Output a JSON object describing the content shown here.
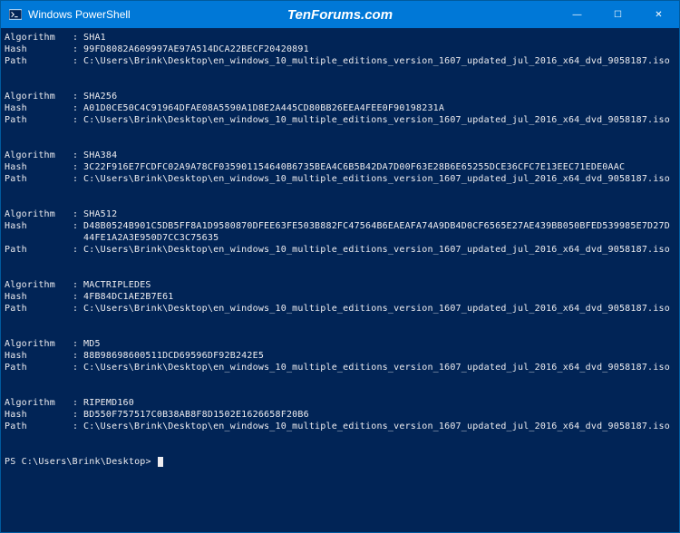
{
  "titlebar": {
    "icon_name": "powershell-icon",
    "title": "Windows PowerShell",
    "watermark": "TenForums.com",
    "min_glyph": "—",
    "max_glyph": "☐",
    "close_glyph": "✕"
  },
  "labels": {
    "algorithm": "Algorithm",
    "hash": "Hash",
    "path": "Path"
  },
  "path": "C:\\Users\\Brink\\Desktop\\en_windows_10_multiple_editions_version_1607_updated_jul_2016_x64_dvd_9058187.iso",
  "results": [
    {
      "algorithm": "SHA1",
      "hash": "99FD8082A609997AE97A514DCA22BECF20420891"
    },
    {
      "algorithm": "SHA256",
      "hash": "A01D0CE50C4C91964DFAE08A5590A1D8E2A445CD80BB26EEA4FEE0F90198231A"
    },
    {
      "algorithm": "SHA384",
      "hash": "3C22F916E7FCDFC02A9A78CF035901154640B6735BEA4C6B5B42DA7D00F63E28B6E65255DCE36CFC7E13EEC71EDE0AAC"
    },
    {
      "algorithm": "SHA512",
      "hash": "D48B0524B901C5DB5FF8A1D9580870DFEE63FE503B882FC47564B6EAEAFA74A9DB4D0CF6565E27AE439BB050BFED539985E7D27D44FE1A2A3E950D7CC3C75635"
    },
    {
      "algorithm": "MACTRIPLEDES",
      "hash": "4FB84DC1AE2B7E61"
    },
    {
      "algorithm": "MD5",
      "hash": "88B98698600511DCD69596DF92B242E5"
    },
    {
      "algorithm": "RIPEMD160",
      "hash": "BD550F757517C0B38AB8F8D1502E1626658F20B6"
    }
  ],
  "prompt": "PS C:\\Users\\Brink\\Desktop> "
}
